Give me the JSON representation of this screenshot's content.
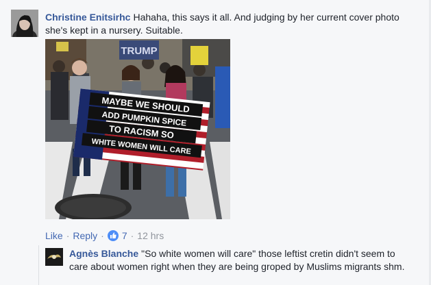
{
  "comment": {
    "author": "Christine Enitsirhc",
    "text": "Hahaha, this says it all. And judging by her current cover photo she's kept in a nursery. Suitable."
  },
  "photo": {
    "sign_top": "TRUMP",
    "banner_lines": [
      "MAYBE WE SHOULD",
      "ADD PUMPKIN SPICE",
      "TO RACISM SO",
      "WHITE WOMEN WILL CARE"
    ]
  },
  "actions": {
    "like": "Like",
    "reply": "Reply",
    "reaction_count": "7",
    "time": "12 hrs"
  },
  "reply": {
    "author": "Agnès Blanche",
    "text": "\"So white women will care\" those leftist cretin didn't seem to care about women right when they are being groped by Muslims migrants shm."
  },
  "colors": {
    "link": "#4267b2",
    "author": "#365899",
    "meta": "#90949c",
    "background": "#f6f7f9"
  }
}
